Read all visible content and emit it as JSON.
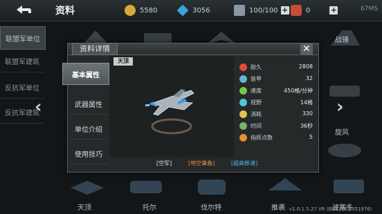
{
  "topbar": {
    "title": "资料",
    "resources": [
      {
        "icon": "gold-coin-icon",
        "value": "5580"
      },
      {
        "icon": "diamond-icon",
        "value": "3056"
      },
      {
        "icon": "supply-crate-icon",
        "value": "100/100"
      },
      {
        "icon": "medal-icon",
        "value": "0"
      }
    ],
    "ping": "67MS"
  },
  "background": {
    "sidebar_tabs": [
      "联盟军单位",
      "联盟军建筑",
      "反抗军单位",
      "反抗军建筑"
    ],
    "side_labels": [
      "战锤",
      "旋风"
    ],
    "bottom_labels": [
      "天顶",
      "托尔",
      "伐尔特",
      "推袭",
      "波塞冬"
    ],
    "version": "v1.0.1.5.27 VR (BD1) (6.2051976)"
  },
  "modal": {
    "title": "资料详情",
    "menu": [
      "基本属性",
      "武器属性",
      "单位介绍",
      "使用技巧"
    ],
    "unit_name": "天顶",
    "stats": [
      {
        "icon": "heart-icon",
        "label": "耐久",
        "value": "2808",
        "color": "#e84a3a"
      },
      {
        "icon": "shield-icon",
        "label": "装甲",
        "value": "32",
        "color": "#6fb1d6"
      },
      {
        "icon": "speed-arrows-icon",
        "label": "速度",
        "value": "450格/分钟",
        "color": "#7cc44a"
      },
      {
        "icon": "eye-icon",
        "label": "视野",
        "value": "14格",
        "color": "#4fc9d4"
      },
      {
        "icon": "resource-icon",
        "label": "消耗",
        "value": "330",
        "color": "#e3c34a"
      },
      {
        "icon": "clock-icon",
        "label": "时间",
        "value": "36秒",
        "color": "#78b36c"
      },
      {
        "icon": "command-point-icon",
        "label": "指挥点数",
        "value": "5",
        "color": "#e6922f"
      }
    ],
    "tags": [
      {
        "text": "[空军]",
        "color": "#e0e6e8"
      },
      {
        "text": "[地空兼备]",
        "color": "#e8913a"
      },
      {
        "text": "[超高移速]",
        "color": "#4fb8e8"
      }
    ]
  }
}
